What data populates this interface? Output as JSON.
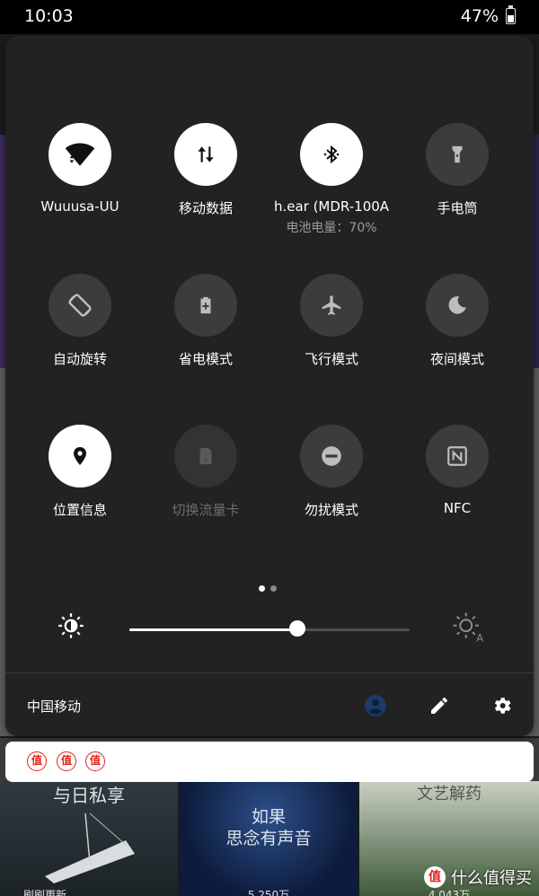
{
  "status_bar": {
    "time": "10:03",
    "battery_percent": "47%",
    "battery_level": 0.47
  },
  "tiles": [
    {
      "label": "Wuuusa-UU",
      "sub": "",
      "state": "on",
      "icon": "wifi-icon"
    },
    {
      "label": "移动数据",
      "sub": "",
      "state": "on",
      "icon": "mobile-data-icon"
    },
    {
      "label": "h.ear (MDR-100A",
      "sub": "电池电量：70%",
      "state": "on",
      "icon": "bluetooth-icon"
    },
    {
      "label": "手电筒",
      "sub": "",
      "state": "off",
      "icon": "flashlight-icon"
    },
    {
      "label": "自动旋转",
      "sub": "",
      "state": "off",
      "icon": "auto-rotate-icon"
    },
    {
      "label": "省电模式",
      "sub": "",
      "state": "off",
      "icon": "battery-saver-icon"
    },
    {
      "label": "飞行模式",
      "sub": "",
      "state": "off",
      "icon": "airplane-icon"
    },
    {
      "label": "夜间模式",
      "sub": "",
      "state": "off",
      "icon": "moon-icon"
    },
    {
      "label": "位置信息",
      "sub": "",
      "state": "on",
      "icon": "location-icon"
    },
    {
      "label": "切换流量卡",
      "sub": "",
      "state": "disabled",
      "icon": "sim-card-icon"
    },
    {
      "label": "勿扰模式",
      "sub": "",
      "state": "off",
      "icon": "do-not-disturb-icon"
    },
    {
      "label": "NFC",
      "sub": "",
      "state": "off",
      "icon": "nfc-icon"
    }
  ],
  "pager": {
    "pages": 2,
    "current": 1
  },
  "brightness": {
    "level": 0.6
  },
  "footer": {
    "carrier": "中国移动"
  },
  "notification": {
    "badges": [
      "值",
      "值",
      "值"
    ]
  },
  "background_app": {
    "card_captions": [
      "与日私享",
      "如果\n思念有声音",
      "文艺解药"
    ],
    "card_bottoms": [
      "刷刷更新",
      "5,250万",
      "4,043万"
    ]
  },
  "watermark": {
    "badge": "值",
    "text": "什么值得买"
  },
  "colors": {
    "tile_on": "#ffffff",
    "tile_off": "#3c3c3c",
    "panel": "#222222",
    "accent_red": "#e2231a"
  }
}
